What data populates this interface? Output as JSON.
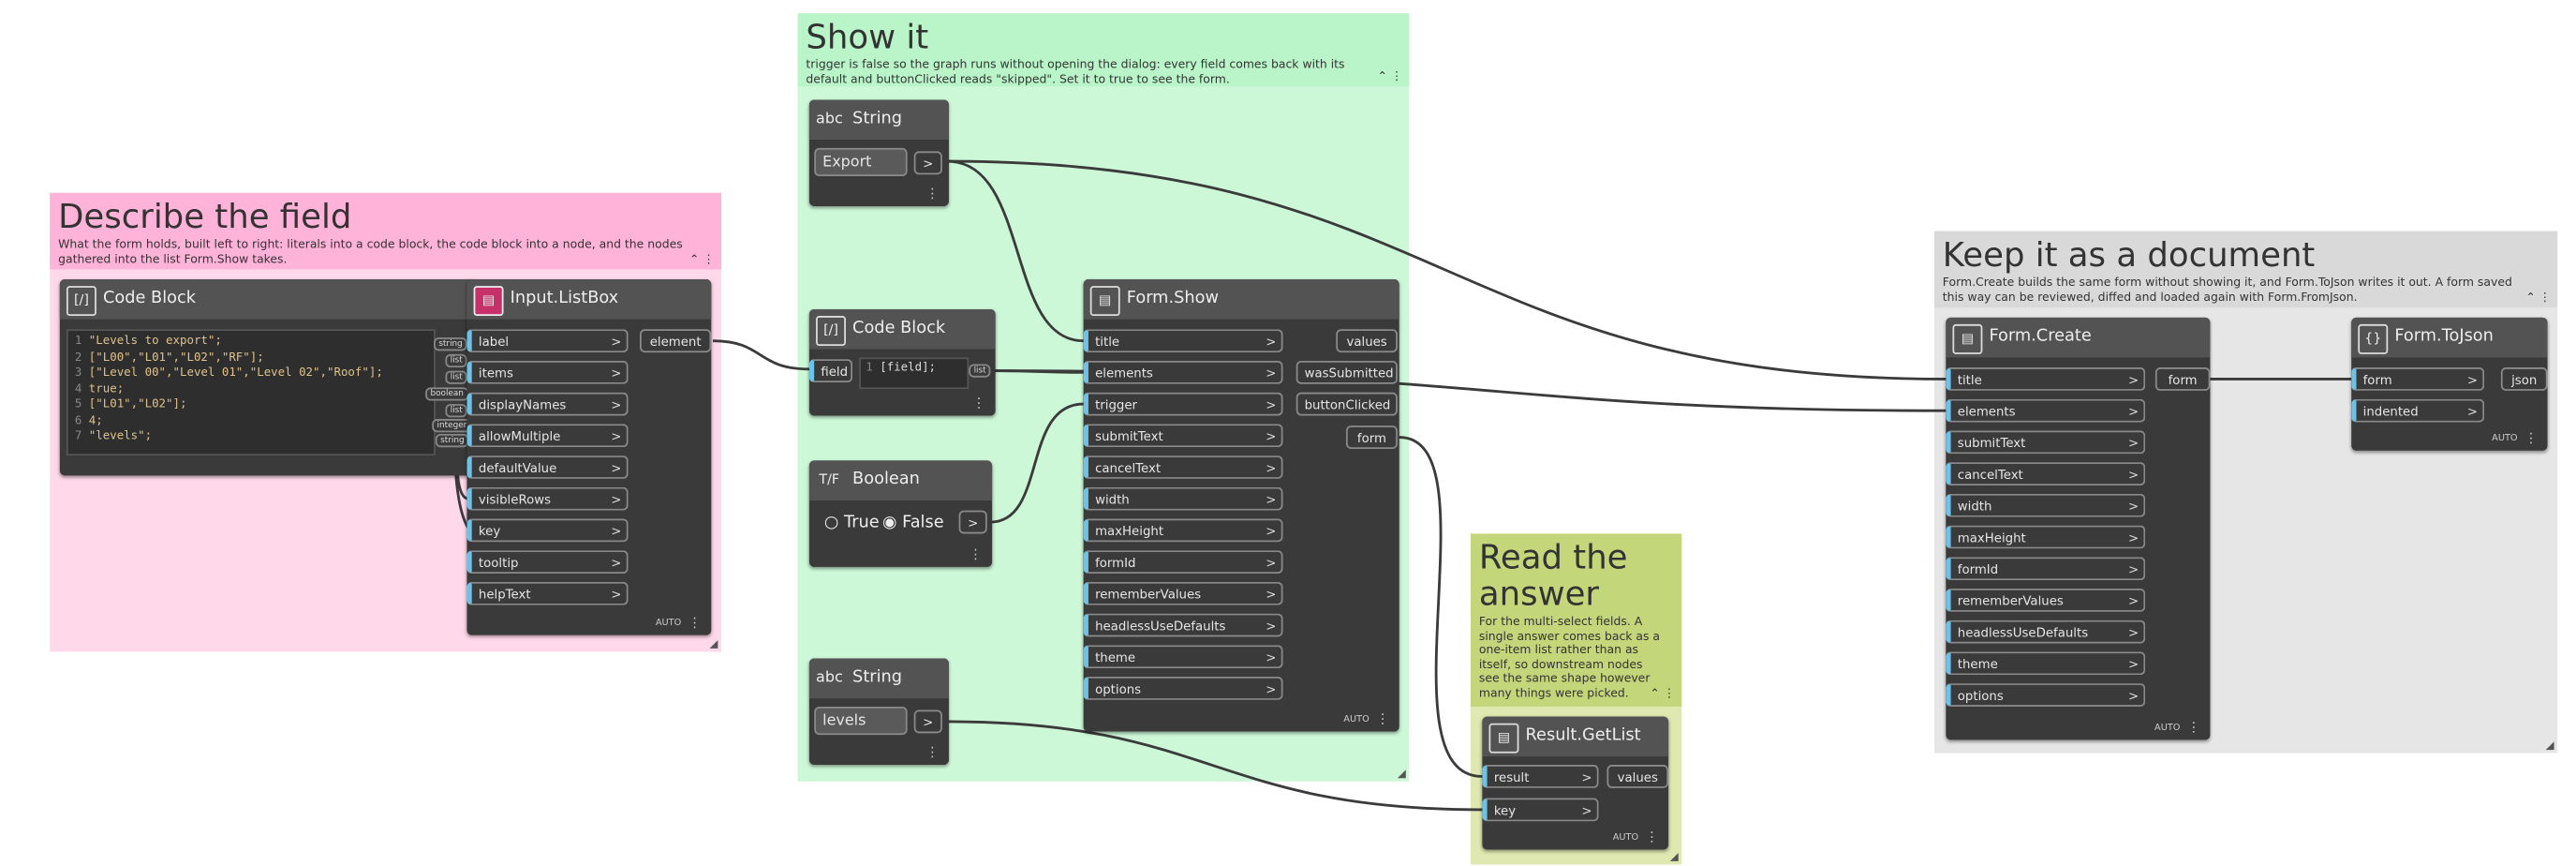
{
  "groups": {
    "describe": {
      "title": "Describe the field",
      "desc": "What the form holds, built left to right: literals into a code block, the code block into a node, and the nodes gathered into the list Form.Show takes.",
      "color": "#ffb3d9"
    },
    "show": {
      "title": "Show it",
      "desc": "trigger is false so the graph runs without opening the dialog: every field comes back with its default and buttonClicked reads \"skipped\". Set it to true to see the form.",
      "color": "#b9f5c8"
    },
    "read": {
      "title": "Read the answer",
      "desc": "For the multi-select fields. A single answer comes back as a one-item list rather than as itself, so downstream nodes see the same shape however many things were picked.",
      "color": "#c4d67a"
    },
    "keep": {
      "title": "Keep it as a document",
      "desc": "Form.Create builds the same form without showing it, and Form.ToJson writes it out. A form saved this way can be reviewed, diffed and loaded again with Form.FromJson.",
      "color": "#d9d9d9"
    }
  },
  "nodes": {
    "codeblock1": {
      "title": "Code Block",
      "lines": [
        {
          "n": "1",
          "t": "\"Levels to export\";"
        },
        {
          "n": "2",
          "t": "[\"L00\",\"L01\",\"L02\",\"RF\"];"
        },
        {
          "n": "3",
          "t": "[\"Level 00\",\"Level 01\",\"Level 02\",\"Roof\"];"
        },
        {
          "n": "4",
          "t": "true;"
        },
        {
          "n": "5",
          "t": "[\"L01\",\"L02\"];"
        },
        {
          "n": "6",
          "t": "4;"
        },
        {
          "n": "7",
          "t": "\"levels\";"
        }
      ],
      "chips": [
        "string",
        "list",
        "list",
        "boolean",
        "list",
        "integer",
        "string"
      ]
    },
    "listbox": {
      "title": "Input.ListBox",
      "inputs": [
        "label",
        "items",
        "displayNames",
        "allowMultiple",
        "defaultValue",
        "visibleRows",
        "key",
        "tooltip",
        "helpText"
      ],
      "output": "element",
      "auto": "AUTO"
    },
    "string1": {
      "title": "String",
      "value": "Export",
      "out": ">"
    },
    "codeblock2": {
      "title": "Code Block",
      "input": "field",
      "line_n": "1",
      "code": "[field];",
      "output": "list"
    },
    "boolean": {
      "title": "Boolean",
      "opt_true": "True",
      "opt_false": "False",
      "out": ">"
    },
    "string2": {
      "title": "String",
      "value": "levels",
      "out": ">"
    },
    "formshow": {
      "title": "Form.Show",
      "inputs": [
        "title",
        "elements",
        "trigger",
        "submitText",
        "cancelText",
        "width",
        "maxHeight",
        "formId",
        "rememberValues",
        "headlessUseDefaults",
        "theme",
        "options"
      ],
      "outputs": [
        "values",
        "wasSubmitted",
        "buttonClicked",
        "form"
      ],
      "auto": "AUTO"
    },
    "getlist": {
      "title": "Result.GetList",
      "inputs": [
        "result",
        "key"
      ],
      "output": "values",
      "auto": "AUTO"
    },
    "formcreate": {
      "title": "Form.Create",
      "inputs": [
        "title",
        "elements",
        "submitText",
        "cancelText",
        "width",
        "maxHeight",
        "formId",
        "rememberValues",
        "headlessUseDefaults",
        "theme",
        "options"
      ],
      "output": "form",
      "auto": "AUTO"
    },
    "tojson": {
      "title": "Form.ToJson",
      "inputs": [
        "form",
        "indented"
      ],
      "output": "json",
      "auto": "AUTO"
    }
  },
  "icons": {
    "string": "abc-icon",
    "codeblock": "code-block-icon",
    "boolean": "boolean-icon",
    "node": "node-icon",
    "json": "json-icon"
  },
  "colors": {
    "port_accent": "#6cc2e8",
    "node_body": "#3a3a3a",
    "node_header": "#535353"
  }
}
